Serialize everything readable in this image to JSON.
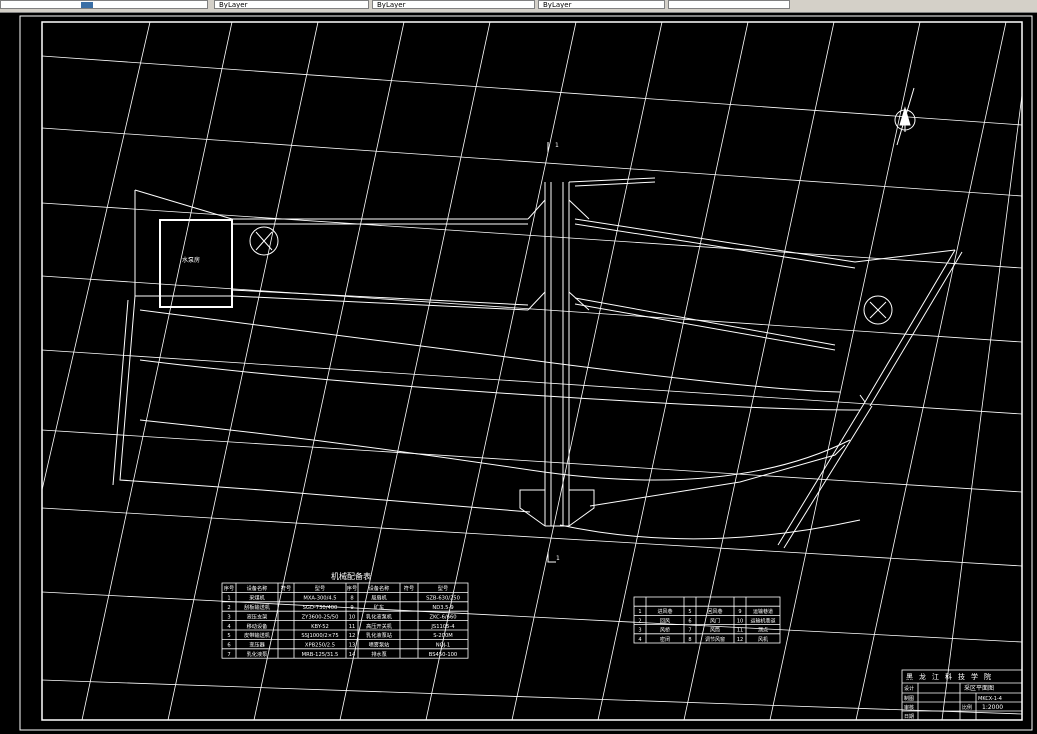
{
  "toolbar": {
    "seg1": "",
    "seg2": "ByLayer",
    "seg3": "ByLayer",
    "seg4": "ByLayer",
    "seg5": ""
  },
  "drawing": {
    "room_label": "水泵房",
    "section_top": "1",
    "section_bottom": "1"
  },
  "equipment_table": {
    "title": "机械配备表",
    "headers": [
      "序号",
      "设备名称",
      "符号",
      "型号",
      "序号",
      "设备名称",
      "符号",
      "型号"
    ],
    "rows": [
      [
        "1",
        "采煤机",
        "",
        "MXA-300/4.5",
        "8",
        "局扇机",
        "",
        "SZB-630/250"
      ],
      [
        "2",
        "刮板输送机",
        "",
        "SGD-730/400",
        "9",
        "矿车",
        "",
        "ND3.5-9"
      ],
      [
        "3",
        "液压支架",
        "",
        "ZY3600-25/50",
        "10",
        "乳化液泵机",
        "",
        "ZKC-6/660"
      ],
      [
        "4",
        "移动设备",
        "",
        "KBY-52",
        "11",
        "高压开关机",
        "",
        "JS1105-4"
      ],
      [
        "5",
        "皮带输送机",
        "",
        "SSJ1000/2×75",
        "12",
        "乳化液泵站",
        "",
        "S-200M"
      ],
      [
        "6",
        "变压器",
        "",
        "XPB250/2.5",
        "13",
        "喷雾泵站",
        "",
        "NQJ-1"
      ],
      [
        "7",
        "乳化液泵",
        "",
        "MRB-125/31.5",
        "14",
        "排水泵",
        "",
        "BS450-100"
      ]
    ]
  },
  "legend_table": {
    "rows": [
      [
        "1",
        "进风巷",
        "5",
        "回风巷",
        "9",
        "运输巷道"
      ],
      [
        "2",
        "回风",
        "6",
        "风门",
        "10",
        "运输机巷道"
      ],
      [
        "3",
        "风桥",
        "7",
        "风筒",
        "11",
        "测点"
      ],
      [
        "4",
        "密闭",
        "8",
        "调节风窗",
        "12",
        "风机"
      ]
    ]
  },
  "title_block": {
    "institute": "黑龙江科技学院",
    "sheet_title": "采区平面图",
    "drawing_no": "MKCX-1-4",
    "scale_label": "比例",
    "scale": "1:2000",
    "row_labels": [
      "设计",
      "制图",
      "审核",
      "日期"
    ]
  },
  "colors": {
    "background": "#000000",
    "lines": "#ffffff",
    "toolbar": "#d4d0c8"
  }
}
